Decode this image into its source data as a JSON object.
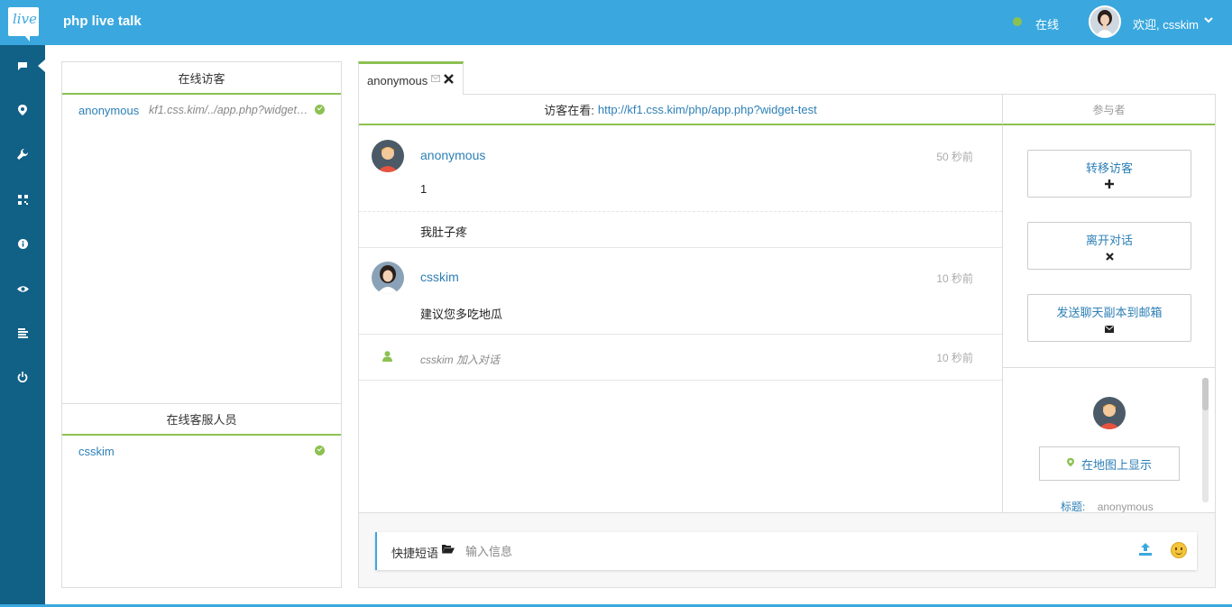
{
  "app": {
    "logo_text": "live",
    "title": "php live talk"
  },
  "header": {
    "status": "在线",
    "welcome": "欢迎, csskim",
    "status_color": "#8cc152"
  },
  "sidebar": {
    "icons": [
      "chat-icon",
      "map-marker-icon",
      "wrench-icon",
      "qrcode-icon",
      "info-icon",
      "eye-icon",
      "list-icon",
      "power-icon"
    ]
  },
  "visitors_panel": {
    "title": "在线访客",
    "items": [
      {
        "name": "anonymous",
        "url": "kf1.css.kim/../app.php?widget-test"
      }
    ]
  },
  "staff_panel": {
    "title": "在线客服人员",
    "items": [
      {
        "name": "csskim"
      }
    ]
  },
  "chat": {
    "tab_label": "anonymous",
    "viewing_label": "访客在看:",
    "viewing_url": "http://kf1.css.kim/php/app.php?widget-test",
    "participants_label": "参与者",
    "messages": [
      {
        "name": "anonymous",
        "time": "50 秒前",
        "lines": [
          "1",
          "我肚子疼"
        ]
      },
      {
        "name": "csskim",
        "time": "10 秒前",
        "lines": [
          "建议您多吃地瓜"
        ]
      }
    ],
    "system": {
      "text": "csskim 加入对话",
      "time": "10 秒前"
    }
  },
  "actions": {
    "transfer": "转移访客",
    "leave": "离开对话",
    "email": "发送聊天副本到邮箱"
  },
  "participant": {
    "map_button": "在地图上显示",
    "title_label": "标题:",
    "title_value": "anonymous"
  },
  "composer": {
    "quick_label": "快捷短语",
    "placeholder": "输入信息"
  },
  "colors": {
    "primary": "#3aa8df",
    "sidebar": "#116086",
    "accent": "#8cc152",
    "link": "#2d7fb6"
  }
}
